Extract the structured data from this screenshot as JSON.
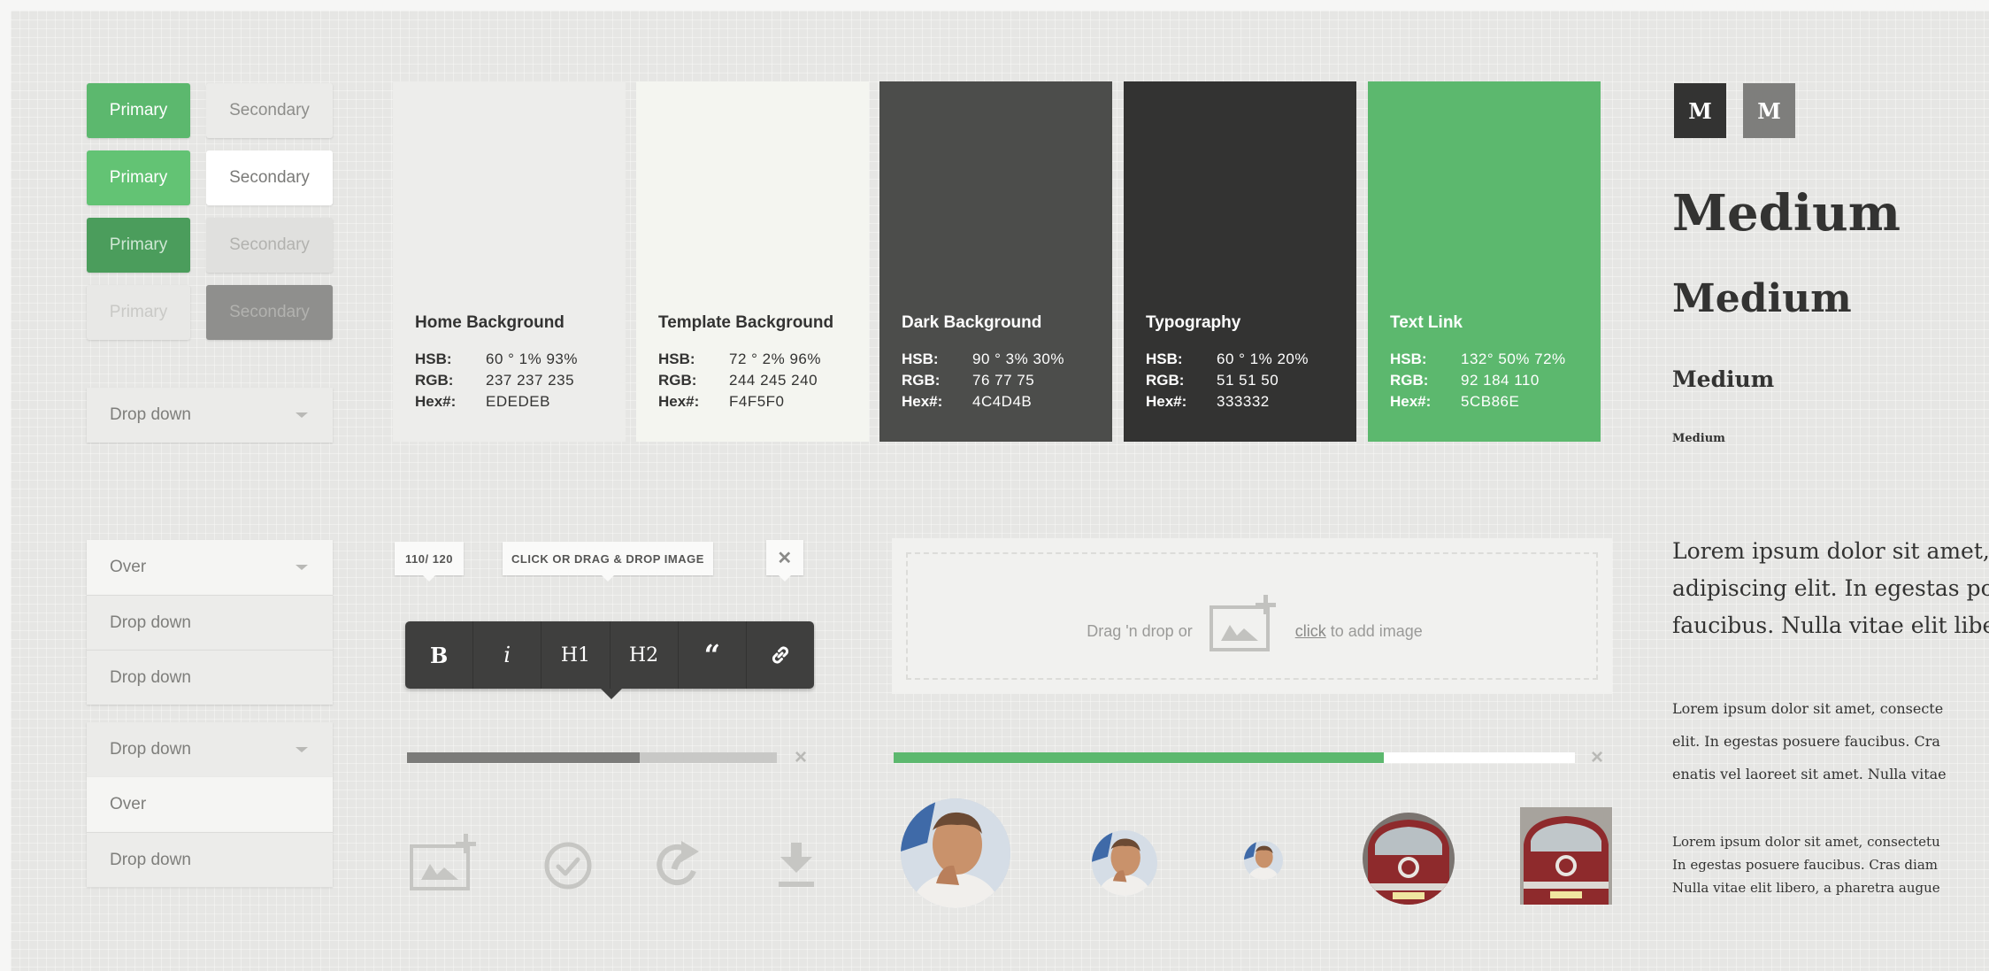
{
  "buttons": {
    "primary_label": "Primary",
    "secondary_label": "Secondary",
    "rows": [
      {
        "primary_color": "#5cb86e",
        "secondary_color": "#ebebe9"
      },
      {
        "primary_color": "#63c374",
        "secondary_color": "#ffffff"
      },
      {
        "primary_color": "#4b9d5c",
        "secondary_color": "#e0e0de"
      },
      {
        "primary_color": "#e8e8e6",
        "secondary_color": "#8f8f8d"
      }
    ]
  },
  "dropdowns": {
    "single": {
      "label": "Drop down"
    },
    "open_group_1": [
      "Over",
      "Drop down",
      "Drop down"
    ],
    "open_group_2": [
      "Drop down",
      "Over",
      "Drop down"
    ]
  },
  "swatches": [
    {
      "title": "Home Background",
      "hsb": "60 ° 1% 93%",
      "rgb": "237 237 235",
      "hex": "EDEDEB",
      "color": "#ededeb",
      "text_color": "#333332"
    },
    {
      "title": "Template Background",
      "hsb": "72 ° 2% 96%",
      "rgb": "244 245 240",
      "hex": "F4F5F0",
      "color": "#f4f5f0",
      "text_color": "#333332"
    },
    {
      "title": "Dark Background",
      "hsb": "90 ° 3% 30%",
      "rgb": "76 77 75",
      "hex": "4C4D4B",
      "color": "#4c4d4b",
      "text_color": "#ffffff"
    },
    {
      "title": "Typography",
      "hsb": "60 ° 1% 20%",
      "rgb": "51 51 50",
      "hex": "333332",
      "color": "#333332",
      "text_color": "#ffffff"
    },
    {
      "title": "Text Link",
      "hsb": "132° 50% 72%",
      "rgb": "92 184 110",
      "hex": "5CB86E",
      "color": "#5cb86e",
      "text_color": "#ffffff"
    }
  ],
  "swatch_keys": {
    "hsb": "HSB:",
    "rgb": "RGB:",
    "hex": "Hex#:"
  },
  "logo": {
    "letter": "M"
  },
  "typography": {
    "h1": "Medium",
    "h2": "Medium",
    "h3": "Medium",
    "h4": "Medium",
    "para_large": [
      "Lorem ipsum dolor sit amet, c",
      "adipiscing elit. In egestas pos",
      "faucibus. Nulla vitae elit liber"
    ],
    "para_medium": [
      "Lorem ipsum dolor sit amet, consecte",
      "elit. In egestas posuere faucibus. Cra",
      "enatis vel laoreet sit amet. Nulla vitae"
    ],
    "para_small": [
      "Lorem ipsum dolor sit amet, consectetu",
      "In egestas posuere faucibus. Cras diam",
      "Nulla vitae elit libero, a pharetra augue"
    ]
  },
  "editor": {
    "counter": "110/ 120",
    "drop_tip": "CLICK OR DRAG & DROP IMAGE",
    "close": "✕",
    "tools": [
      "B",
      "i",
      "H1",
      "H2",
      "“",
      "link"
    ]
  },
  "upload": {
    "prefix": "Drag 'n drop or",
    "link": "click",
    "suffix": "to add image"
  },
  "progress": [
    {
      "value": 0.63,
      "fill": "#7b7b79",
      "track": "#c8c8c6"
    },
    {
      "value": 0.72,
      "fill": "#5cb86e",
      "track": "#ffffff"
    }
  ],
  "icons": [
    "add-image-icon",
    "checkmark-icon",
    "share-icon",
    "download-icon"
  ]
}
